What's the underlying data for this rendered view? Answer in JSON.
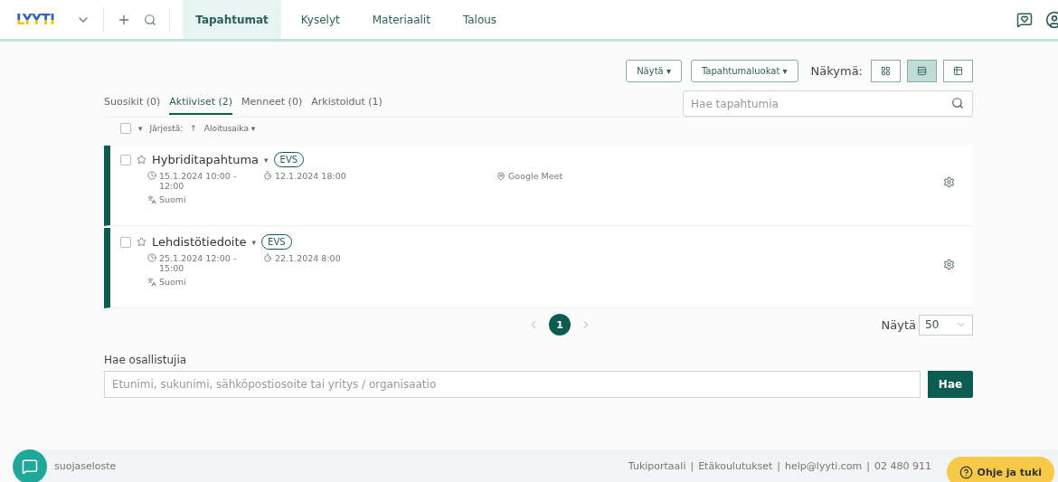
{
  "topbar": {
    "logo": "LYYTI",
    "nav": [
      {
        "label": "Tapahtumat",
        "selected": true
      },
      {
        "label": "Kyselyt",
        "selected": false
      },
      {
        "label": "Materiaalit",
        "selected": false
      },
      {
        "label": "Talous",
        "selected": false
      }
    ]
  },
  "toolbar": {
    "buttons": [
      "Näytä ▾",
      "Tapahtumaluokat ▾"
    ],
    "view_label": "Näkymä:",
    "views": [
      {
        "kind": "grid",
        "selected": false
      },
      {
        "kind": "list",
        "selected": true
      },
      {
        "kind": "table",
        "selected": false
      }
    ]
  },
  "filter_tabs": [
    {
      "label": "Suosikit (0)",
      "selected": false
    },
    {
      "label": "Aktiiviset (2)",
      "selected": true
    },
    {
      "label": "Menneet (0)",
      "selected": false
    },
    {
      "label": "Arkistoidut (1)",
      "selected": false
    }
  ],
  "search": {
    "placeholder": "Hae tapahtumia"
  },
  "sort": {
    "caret": "▾",
    "label": "Järjestä:",
    "direction": "↑",
    "field": "Aloitusaika ▾",
    "checked": false
  },
  "events": [
    {
      "title": "Hybriditapahtuma",
      "caret": "▾",
      "tag": "EVS",
      "checked": false,
      "favorite": false,
      "time": "15.1.2024 10:00 - 12:00",
      "deadline": "12.1.2024 18:00",
      "location": "Google Meet",
      "language": "Suomi"
    },
    {
      "title": "Lehdistötiedoite",
      "caret": "▾",
      "tag": "EVS",
      "checked": false,
      "favorite": false,
      "time": "25.1.2024 12:00 - 15:00",
      "deadline": "22.1.2024 8:00",
      "language": "Suomi"
    }
  ],
  "pagination": {
    "pages": [
      {
        "label": "1",
        "selected": true
      }
    ],
    "page_size_label": "Näytä",
    "page_size": "50"
  },
  "participant_search": {
    "label": "Hae osallistujia",
    "placeholder": "Etunimi, sukunimi, sähköpostiosoite tai yritys / organisaatio",
    "button": "Hae"
  },
  "footer": {
    "left": "suojaseloste",
    "links": [
      "Tukiportaali",
      "Etäkoulutukset",
      "help@lyyti.com",
      "02 480 911"
    ],
    "separator": "|",
    "help_button": "Ohje ja tuki"
  }
}
